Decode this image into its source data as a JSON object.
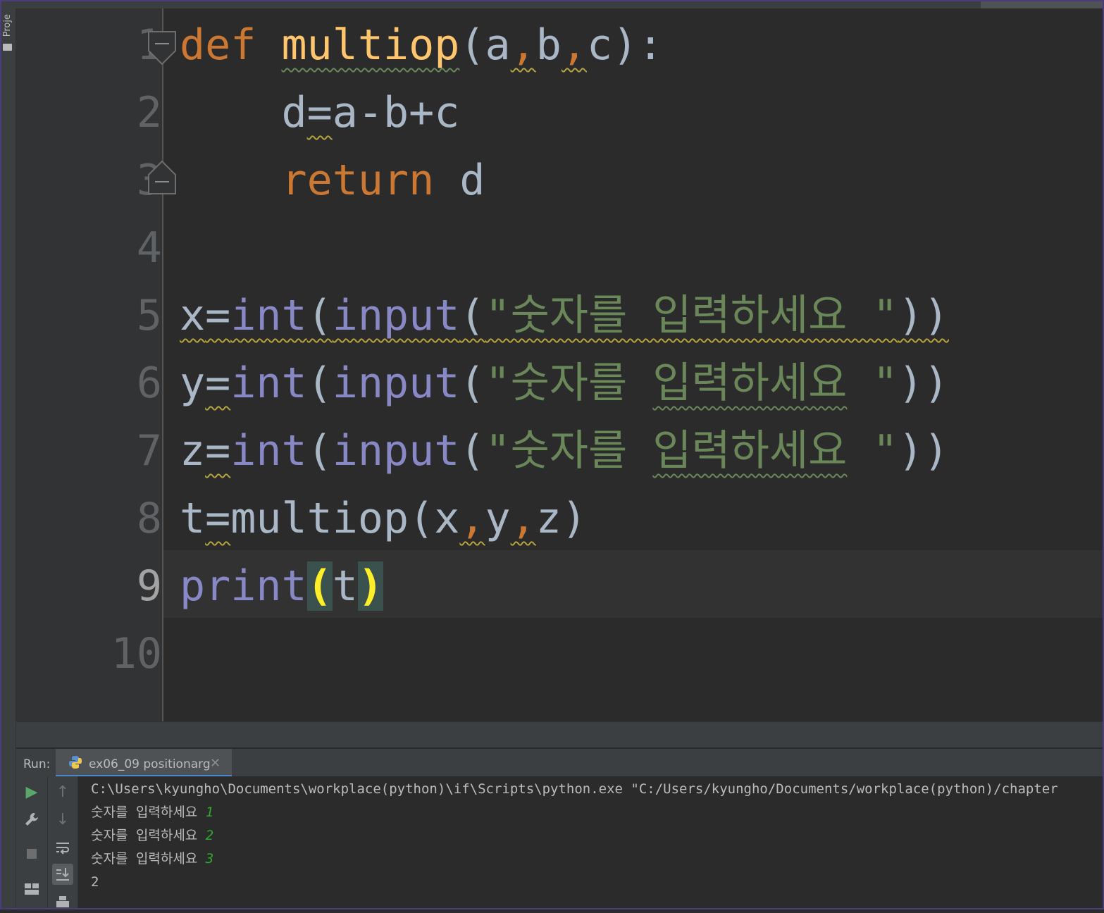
{
  "editor": {
    "line_numbers": [
      "1",
      "2",
      "3",
      "4",
      "5",
      "6",
      "7",
      "8",
      "9",
      "10"
    ],
    "current_line": "9",
    "code": {
      "l1": {
        "kw": "def",
        "fn": "multiop",
        "open": "(",
        "p1": "a",
        "c1": ",",
        "p2": "b",
        "c2": ",",
        "p3": "c",
        "close": "):"
      },
      "l2": {
        "indent": "    ",
        "lhs": "d",
        "eq": "=",
        "rhs": "a-b+c"
      },
      "l3": {
        "indent": "    ",
        "kw": "return",
        "sp": " ",
        "val": "d"
      },
      "l5": {
        "lhs": "x",
        "eq": "=",
        "f1": "int",
        "o1": "(",
        "f2": "input",
        "o2": "(",
        "str": "\"숫자를 입력하세요 \"",
        "close": "))"
      },
      "l6": {
        "lhs": "y",
        "eq": "=",
        "f1": "int",
        "o1": "(",
        "f2": "input",
        "o2": "(",
        "q1": "\"",
        "s1": "숫자를 ",
        "s2": "입력하세요",
        "q2": " \"",
        "close": "))"
      },
      "l7": {
        "lhs": "z",
        "eq": "=",
        "f1": "int",
        "o1": "(",
        "f2": "input",
        "o2": "(",
        "q1": "\"",
        "s1": "숫자를 ",
        "s2": "입력하세요",
        "q2": " \"",
        "close": "))"
      },
      "l8": {
        "lhs": "t",
        "eq": "=",
        "call": "multiop",
        "open": "(",
        "a1": "x",
        "c1": ",",
        "a2": "y",
        "c2": ",",
        "a3": "z",
        "close": ")"
      },
      "l9": {
        "fn": "print",
        "open": "(",
        "arg": "t",
        "close": ")"
      }
    }
  },
  "sidebar": {
    "project_label": "Proje"
  },
  "run_panel": {
    "label": "Run:",
    "tab_label": "ex06_09 positionarg",
    "close_glyph": "✕"
  },
  "console": {
    "command": "C:\\Users\\kyungho\\Documents\\workplace(python)\\if\\Scripts\\python.exe \"C:/Users/kyungho/Documents/workplace(python)/chapter",
    "prompts": [
      {
        "prompt": "숫자를 입력하세요 ",
        "input": "1"
      },
      {
        "prompt": "숫자를 입력하세요 ",
        "input": "2"
      },
      {
        "prompt": "숫자를 입력하세요 ",
        "input": "3"
      }
    ],
    "result": "2"
  },
  "colors": {
    "background": "#2b2b2b",
    "keyword": "#cc7832",
    "function_def": "#ffc66d",
    "builtin": "#8888c6",
    "string": "#6a8759",
    "plain": "#a9b7c6",
    "run_icon": "#59a869",
    "user_input": "#2fa82f"
  },
  "icons": [
    "play-icon",
    "wrench-icon",
    "stop-icon",
    "layout-icon",
    "up-arrow-icon",
    "down-arrow-icon",
    "soft-wrap-icon",
    "scroll-to-end-icon",
    "print-icon",
    "python-icon",
    "fold-marker-icon"
  ]
}
